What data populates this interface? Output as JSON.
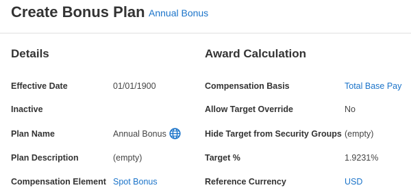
{
  "header": {
    "title": "Create Bonus Plan",
    "plan_link": "Annual Bonus"
  },
  "details": {
    "title": "Details",
    "rows": [
      {
        "label": "Effective Date",
        "value": "01/01/1900"
      },
      {
        "label": "Inactive",
        "value": ""
      },
      {
        "label": "Plan Name",
        "value": "Annual Bonus"
      },
      {
        "label": "Plan Description",
        "value": "(empty)"
      },
      {
        "label": "Compensation Element",
        "value": "Spot Bonus"
      }
    ]
  },
  "award": {
    "title": "Award Calculation",
    "rows": [
      {
        "label": "Compensation Basis",
        "value": "Total Base Pay"
      },
      {
        "label": "Allow Target Override",
        "value": "No"
      },
      {
        "label": "Hide Target from Security Groups",
        "value": "(empty)"
      },
      {
        "label": "Target %",
        "value": "1.9231%"
      },
      {
        "label": "Reference Currency",
        "value": "USD"
      }
    ]
  },
  "colors": {
    "link": "#1a73c9",
    "globe": "#1a73c9"
  },
  "icons": {
    "translate": "globe-icon"
  }
}
